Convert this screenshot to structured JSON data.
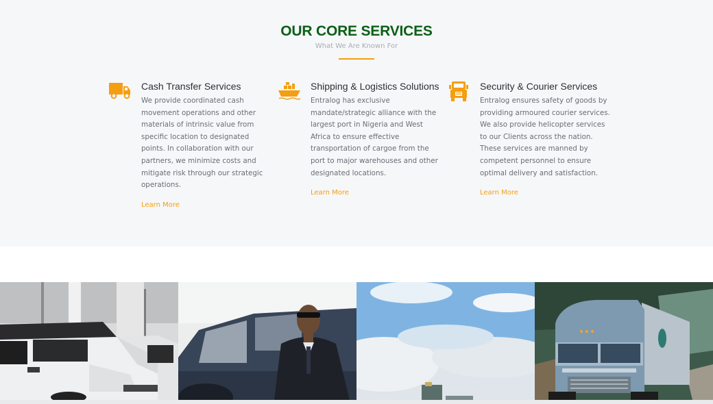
{
  "section": {
    "title": "OUR CORE SERVICES",
    "subtitle": "What We Are Known For"
  },
  "services": [
    {
      "icon": "truck-icon",
      "title": "Cash Transfer Services",
      "description": "We provide coordinated cash movement operations and other materials of intrinsic value from specific location to designated points. In collaboration with our partners, we minimize costs and mitigate risk through our strategic operations.",
      "link": "Learn More"
    },
    {
      "icon": "ship-icon",
      "title": "Shipping & Logistics Solutions",
      "description": "Entralog has exclusive mandate/strategic alliance with the largest port in Nigeria and West Africa to ensure effective transportation of cargoe from the port to major warehouses and other designated locations.",
      "link": "Learn More"
    },
    {
      "icon": "truck-front-icon",
      "title": "Security & Courier Services",
      "description": "Entralog ensures safety of goods by providing armoured courier services. We also provide helicopter services to our Clients across the nation. These services are manned by competent personnel to ensure optimal delivery and satisfaction.",
      "link": "Learn More"
    }
  ],
  "gallery": [
    {
      "image": "armoured-vehicle-photo"
    },
    {
      "image": "security-guard-photo"
    },
    {
      "image": "port-sky-photo"
    },
    {
      "image": "truck-highway-photo"
    }
  ],
  "colors": {
    "title": "#0b5f16",
    "accent": "#f49e12",
    "section_bg": "#f6f7f9"
  }
}
